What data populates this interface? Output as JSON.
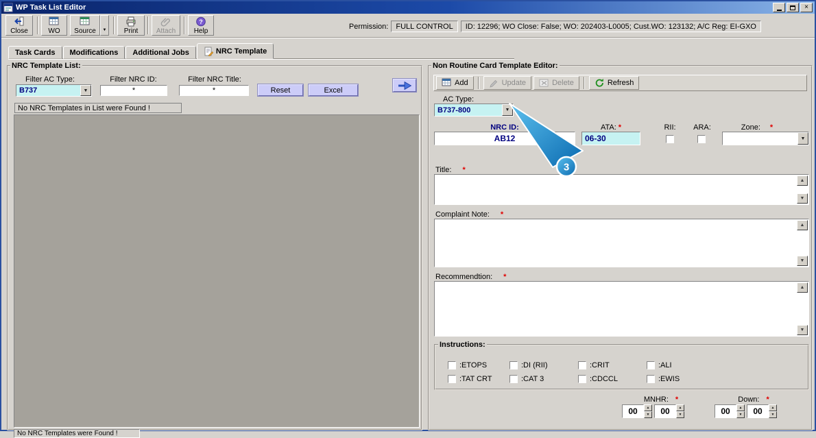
{
  "window": {
    "title": "WP Task List Editor"
  },
  "icons": {
    "dropdown_arrow": "▼",
    "spin_up": "▲",
    "spin_down": "▼",
    "close_window": "×"
  },
  "required_marker": "*",
  "toolbar": {
    "buttons": [
      {
        "label": "Close"
      },
      {
        "label": "WO"
      },
      {
        "label": "Source"
      },
      {
        "label": "Print"
      },
      {
        "label": "Attach"
      },
      {
        "label": "Help"
      }
    ],
    "permission_label": "Permission:",
    "permission_value": "FULL CONTROL",
    "info": "ID: 12296; WO Close: False; WO: 202403-L0005; Cust.WO: 123132; A/C Reg: EI-GXO"
  },
  "tabs": [
    {
      "label": "Task Cards"
    },
    {
      "label": "Modifications"
    },
    {
      "label": "Additional Jobs"
    },
    {
      "label": "NRC Template"
    }
  ],
  "left_panel": {
    "title": "NRC Template List:",
    "filter_ac_type_label": "Filter AC Type:",
    "filter_ac_type_value": "B737",
    "filter_nrc_id_label": "Filter NRC ID:",
    "filter_nrc_id_value": "*",
    "filter_nrc_title_label": "Filter NRC Title:",
    "filter_nrc_title_value": "*",
    "reset_button": "Reset",
    "excel_button": "Excel",
    "empty_message": "No NRC Templates in List were Found !",
    "status_message": "No NRC Templates were Found !"
  },
  "editor": {
    "title": "Non Routine Card Template Editor:",
    "toolbar": {
      "add": "Add",
      "update": "Update",
      "delete": "Delete",
      "refresh": "Refresh"
    },
    "ac_type_label": "AC Type:",
    "ac_type_value": "B737-800",
    "nrc_id_label": "NRC ID:",
    "nrc_id_value": "AB12",
    "ata_label": "ATA:",
    "ata_value": "06-30",
    "rii_label": "RII:",
    "ara_label": "ARA:",
    "zone_label": "Zone:",
    "zone_value": "",
    "title_label": "Title:",
    "complaint_label": "Complaint Note:",
    "recommendation_label": "Recommendtion:",
    "instructions_title": "Instructions:",
    "instructions_row1": [
      ":ETOPS",
      ":DI (RII)",
      ":CRIT",
      ":ALI"
    ],
    "instructions_row2": [
      ":TAT CRT",
      ":CAT 3",
      ":CDCCL",
      ":EWIS"
    ],
    "mnhr_label": "MNHR:",
    "down_label": "Down:",
    "spinners": [
      "00",
      "00",
      "00",
      "00"
    ]
  },
  "callout": {
    "number": "3"
  }
}
